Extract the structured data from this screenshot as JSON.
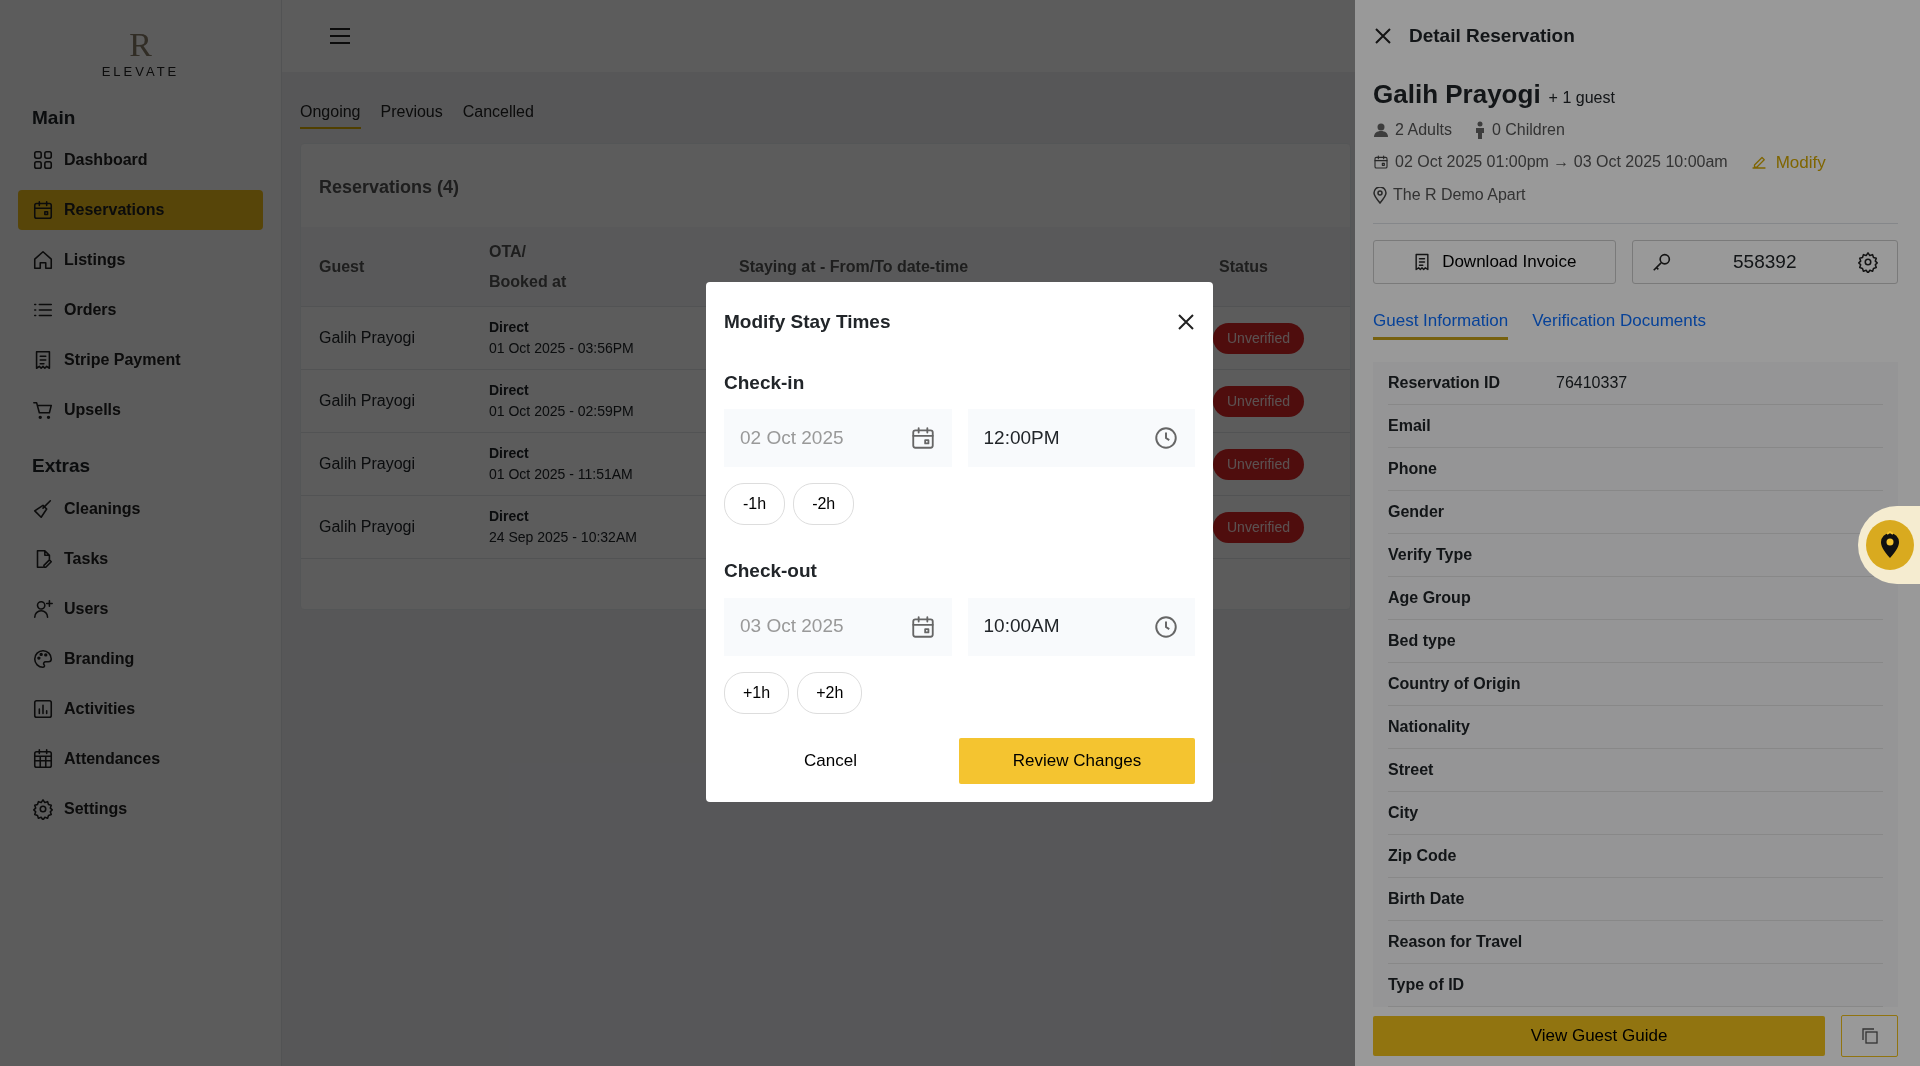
{
  "sidebar": {
    "logo_mark": "R",
    "logo_text": "ELEVATE",
    "sections": [
      {
        "title": "Main",
        "items": [
          {
            "label": "Dashboard",
            "selected": false
          },
          {
            "label": "Reservations",
            "selected": true
          },
          {
            "label": "Listings",
            "selected": false
          },
          {
            "label": "Orders",
            "selected": false
          },
          {
            "label": "Stripe Payment",
            "selected": false
          },
          {
            "label": "Upsells",
            "selected": false
          }
        ]
      },
      {
        "title": "Extras",
        "items": [
          {
            "label": "Cleanings",
            "selected": false
          },
          {
            "label": "Tasks",
            "selected": false
          },
          {
            "label": "Users",
            "selected": false
          },
          {
            "label": "Branding",
            "selected": false
          },
          {
            "label": "Activities",
            "selected": false
          },
          {
            "label": "Attendances",
            "selected": false
          },
          {
            "label": "Settings",
            "selected": false
          }
        ]
      }
    ]
  },
  "tabs": [
    {
      "label": "Ongoing",
      "selected": true
    },
    {
      "label": "Previous",
      "selected": false
    },
    {
      "label": "Cancelled",
      "selected": false
    }
  ],
  "reservations": {
    "title": "Reservations (4)",
    "columns": [
      {
        "lines": [
          "Guest"
        ]
      },
      {
        "lines": [
          "OTA/",
          "Booked at"
        ]
      },
      {
        "lines": [
          "Staying at - From/To date-time"
        ]
      },
      {
        "lines": [
          "Status"
        ]
      }
    ],
    "rows": [
      {
        "guest": "Galih Prayogi",
        "ota": "Direct",
        "booked_at": "01 Oct 2025 - 03:56PM",
        "status": "Unverified"
      },
      {
        "guest": "Galih Prayogi",
        "ota": "Direct",
        "booked_at": "01 Oct 2025 - 02:59PM",
        "status": "Unverified"
      },
      {
        "guest": "Galih Prayogi",
        "ota": "Direct",
        "booked_at": "01 Oct 2025 - 11:51AM",
        "status": "Unverified"
      },
      {
        "guest": "Galih Prayogi",
        "ota": "Direct",
        "booked_at": "24 Sep 2025 - 10:32AM",
        "status": "Unverified"
      }
    ]
  },
  "modal": {
    "title": "Modify Stay Times",
    "sections": [
      {
        "title": "Check-in",
        "date": {
          "value": "02 Oct 2025",
          "disabled": true
        },
        "time": {
          "value": "12:00PM",
          "disabled": false
        },
        "adjust": [
          "-1h",
          "-2h"
        ]
      },
      {
        "title": "Check-out",
        "date": {
          "value": "03 Oct 2025",
          "disabled": true
        },
        "time": {
          "value": "10:00AM",
          "disabled": false
        },
        "adjust": [
          "+1h",
          "+2h"
        ]
      }
    ],
    "cancel": "Cancel",
    "confirm": "Review Changes"
  },
  "detail": {
    "title": "Detail Reservation",
    "guest": "Galih Prayogi",
    "extra_guests": "+ 1 guest",
    "adults": "2 Adults",
    "children": "0 Children",
    "dates": "02 Oct 2025 01:00pm → 03 Oct 2025 10:00am",
    "modify": "Modify",
    "location": "The R Demo Apart",
    "download": "Download Invoice",
    "door_code": "558392",
    "tabs": [
      {
        "label": "Guest Information",
        "selected": true
      },
      {
        "label": "Verification Documents",
        "selected": false
      }
    ],
    "fields": [
      {
        "label": "Reservation ID",
        "value": "76410337"
      },
      {
        "label": "Email"
      },
      {
        "label": "Phone"
      },
      {
        "label": "Gender"
      },
      {
        "label": "Verify Type"
      },
      {
        "label": "Age Group"
      },
      {
        "label": "Bed type"
      },
      {
        "label": "Country of Origin"
      },
      {
        "label": "Nationality"
      },
      {
        "label": "Street"
      },
      {
        "label": "City"
      },
      {
        "label": "Zip Code"
      },
      {
        "label": "Birth Date"
      },
      {
        "label": "Reason for Travel"
      },
      {
        "label": "Type of ID"
      }
    ],
    "guide_button": "View Guest Guide"
  }
}
